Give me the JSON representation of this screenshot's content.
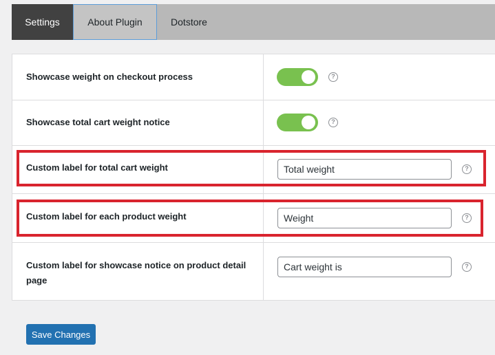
{
  "tabs": {
    "settings": "Settings",
    "about": "About Plugin",
    "dotstore": "Dotstore"
  },
  "rows": {
    "checkout_weight": {
      "label": "Showcase weight on checkout process",
      "enabled": true
    },
    "cart_weight_notice": {
      "label": "Showcase total cart weight notice",
      "enabled": true
    },
    "total_cart_label": {
      "label": "Custom label for total cart weight",
      "value": "Total weight"
    },
    "product_weight_label": {
      "label": "Custom label for each product weight",
      "value": "Weight"
    },
    "product_detail_notice": {
      "label": "Custom label for showcase notice on product detail page",
      "value": "Cart weight is"
    }
  },
  "help_glyph": "?",
  "save_label": "Save Changes",
  "colors": {
    "toggle_on": "#79c14f",
    "highlight": "#d9242e",
    "primary_button": "#2271b1",
    "active_tab": "#414141"
  }
}
